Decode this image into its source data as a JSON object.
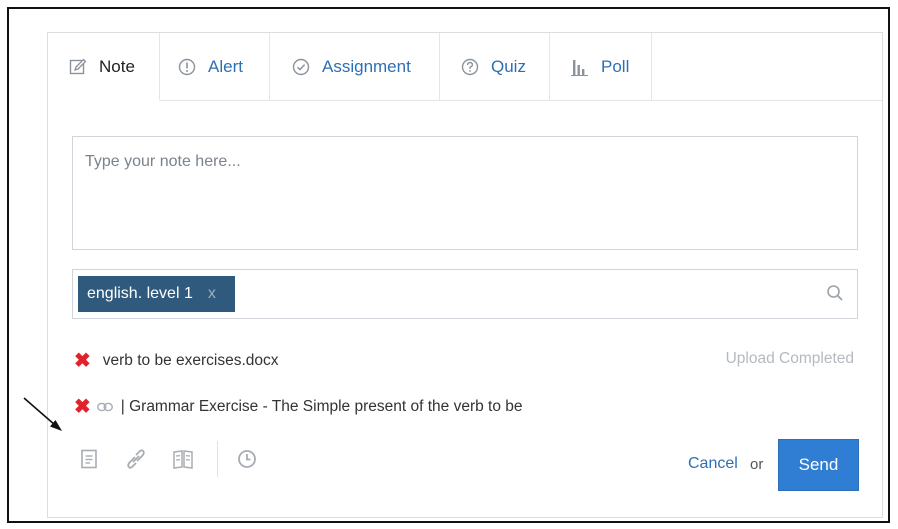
{
  "tabs": [
    {
      "label": "Note",
      "icon": "edit-icon",
      "active": true
    },
    {
      "label": "Alert",
      "icon": "alert-icon",
      "active": false
    },
    {
      "label": "Assignment",
      "icon": "check-circle-icon",
      "active": false
    },
    {
      "label": "Quiz",
      "icon": "question-icon",
      "active": false
    },
    {
      "label": "Poll",
      "icon": "bar-chart-icon",
      "active": false
    }
  ],
  "note": {
    "placeholder": "Type your note here..."
  },
  "recipients": {
    "chip_label": "english. level 1",
    "chip_remove": "x",
    "search_icon": "search-icon"
  },
  "attachments": [
    {
      "name": "verb to be exercises.docx",
      "status": "Upload Completed"
    },
    {
      "name": "| Grammar Exercise - The Simple present of the verb to be",
      "type": "link"
    }
  ],
  "toolbar": {
    "icons": [
      "file-icon",
      "link-icon",
      "library-icon",
      "clock-icon"
    ],
    "cancel_label": "Cancel",
    "or_label": "or",
    "send_label": "Send"
  },
  "colors": {
    "accent": "#2f7ed3",
    "chip": "#2f5a7e",
    "remove": "#e0232b",
    "link": "#2d6fb4"
  }
}
